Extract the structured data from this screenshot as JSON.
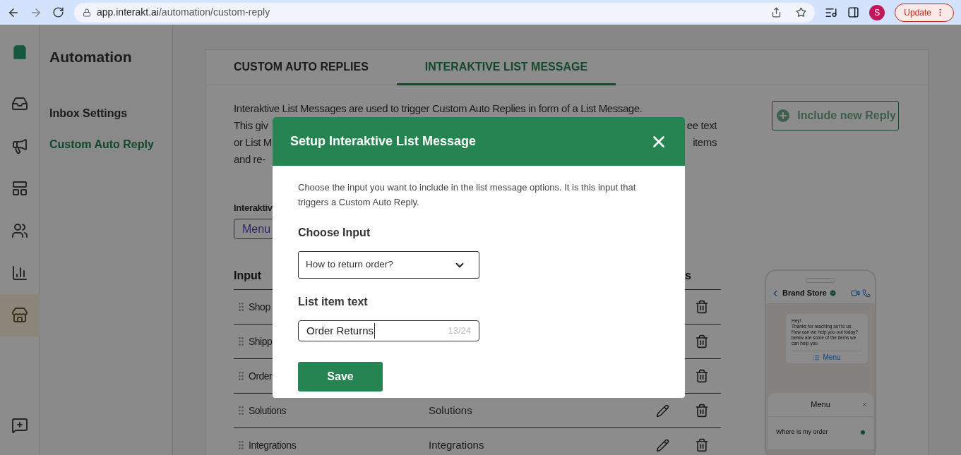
{
  "browser": {
    "url_host": "app.interakt.ai",
    "url_path": "/automation/custom-reply",
    "profile_initial": "S",
    "update_label": "Update"
  },
  "rail": [
    {
      "selected": false
    },
    {
      "selected": false
    },
    {
      "selected": false
    },
    {
      "selected": false
    },
    {
      "selected": false
    },
    {
      "selected": true
    }
  ],
  "sidebar": {
    "title": "Automation",
    "items": [
      {
        "label": "Inbox Settings",
        "selected": false
      },
      {
        "label": "Custom Auto Reply",
        "selected": true
      }
    ]
  },
  "tabs": [
    {
      "label": "CUSTOM AUTO REPLIES",
      "selected": false
    },
    {
      "label": "INTERAKTIVE LIST MESSAGE",
      "selected": true
    }
  ],
  "intro": [
    {
      "left": "Interaktive List Messages are used to trigger Custom Auto Replies in form of a List Message."
    },
    {
      "left": "This giv",
      "right": "ee text"
    },
    {
      "left": "or List M",
      "right": "items"
    },
    {
      "left": "and re-"
    }
  ],
  "include_button": {
    "label": "Include new Reply"
  },
  "list_label": "Interaktiv",
  "chip": "Menu",
  "table": {
    "columns": [
      "Input",
      "s"
    ],
    "rows": [
      {
        "input": "Shop"
      },
      {
        "input": "Shipp"
      },
      {
        "input": "Order"
      },
      {
        "input": "Solutions",
        "reply": "Solutions"
      },
      {
        "input": "Integrations",
        "reply": "Integrations"
      }
    ]
  },
  "phone": {
    "name": "Brand Store",
    "message": "Hey!\nThanks for reaching out to us. How can we help you out today? below are some of the items we can help you",
    "menu_button": "Menu",
    "sheet_title": "Menu",
    "options": [
      {
        "label": "Where is my order",
        "selected": true
      }
    ]
  },
  "modal": {
    "title": "Setup Interaktive List Message",
    "description": "Choose the input you want to include in the list message options. It is this input that triggers a Custom Auto Reply.",
    "choose_label": "Choose Input",
    "choose_value": "How to return order?",
    "text_label": "List item text",
    "text_value": "Order Returns",
    "counter": "13/24",
    "save": "Save"
  }
}
